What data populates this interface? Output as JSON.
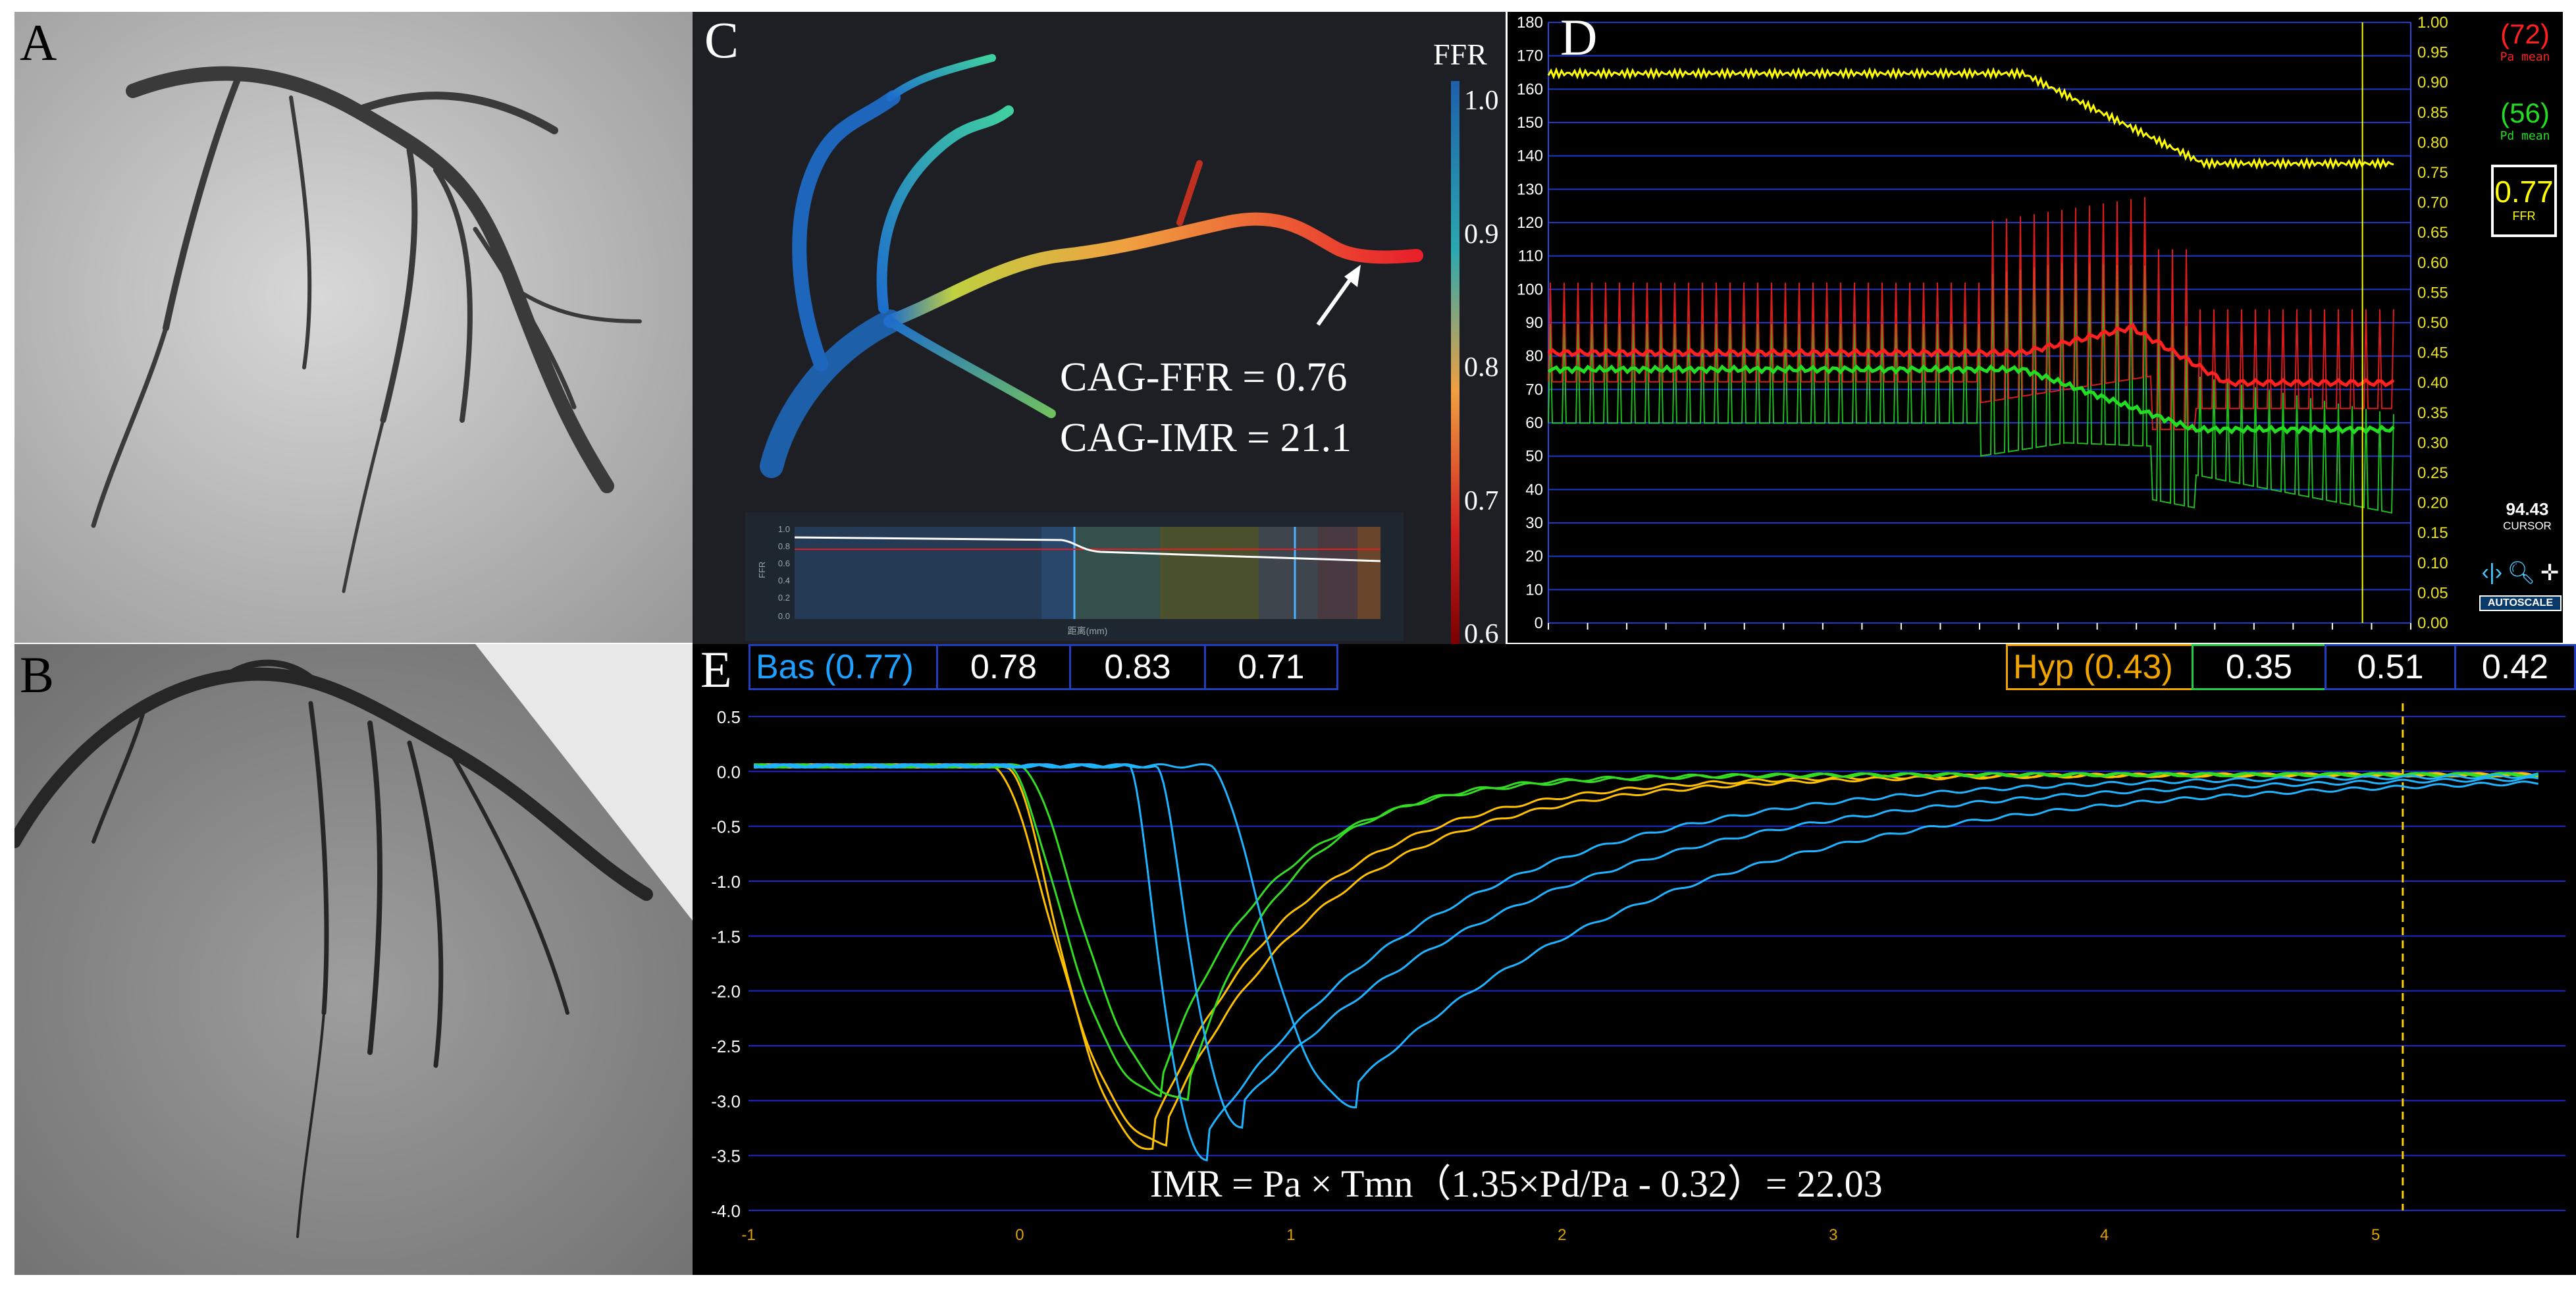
{
  "panels": {
    "A": {
      "label": "A"
    },
    "B": {
      "label": "B"
    },
    "C": {
      "label": "C",
      "colorbar_title": "FFR",
      "colorbar_ticks": [
        "1.0",
        "0.9",
        "0.8",
        "0.7",
        "0.6"
      ],
      "ffr_text": "CAG-FFR = 0.76",
      "imr_text": "CAG-IMR = 21.1",
      "mini_plot": {
        "ylabel": "FFR",
        "xlabel": "距离(mm)",
        "yticks": [
          "1.0",
          "0.8",
          "0.6",
          "0.4",
          "0.2",
          "0.0"
        ]
      }
    },
    "D": {
      "label": "D",
      "left_ticks": [
        "180",
        "170",
        "160",
        "150",
        "140",
        "130",
        "120",
        "110",
        "100",
        "90",
        "80",
        "70",
        "60",
        "50",
        "40",
        "30",
        "20",
        "10",
        "0"
      ],
      "right_ticks": [
        "1.00",
        "0.95",
        "0.90",
        "0.85",
        "0.80",
        "0.75",
        "0.70",
        "0.65",
        "0.60",
        "0.55",
        "0.50",
        "0.45",
        "0.40",
        "0.35",
        "0.30",
        "0.25",
        "0.20",
        "0.15",
        "0.10",
        "0.05",
        "0.00"
      ],
      "pa_value": "(72)",
      "pa_label": "Pa mean",
      "pd_value": "(56)",
      "pd_label": "Pd mean",
      "ffr_value": "0.77",
      "ffr_label": "FFR",
      "cursor_value": "94.43",
      "cursor_label": "CURSOR",
      "autoscale_label": "AUTOSCALE",
      "colors": {
        "ffr": "#ffff00",
        "pa": "#ff2020",
        "pd": "#22dd22"
      }
    },
    "E": {
      "label": "E",
      "bas_label": "Bas",
      "bas_mean": "(0.77)",
      "bas_values": [
        "0.78",
        "0.83",
        "0.71"
      ],
      "hyp_label": "Hyp",
      "hyp_mean": "(0.43)",
      "hyp_values": [
        "0.35",
        "0.51",
        "0.42"
      ],
      "y_ticks": [
        "0.5",
        "0.0",
        "-0.5",
        "-1.0",
        "-1.5",
        "-2.0",
        "-2.5",
        "-3.0",
        "-3.5",
        "-4.0"
      ],
      "x_ticks": [
        "-1",
        "0",
        "1",
        "2",
        "3",
        "4",
        "5"
      ],
      "formula": "IMR = Pa × Tmn（1.35×Pd/Pa - 0.32）= 22.03",
      "colors": {
        "bas": "#1eb4ff",
        "hyp": "#ffc000",
        "green": "#33dd22",
        "bas_header": "#1ea0ff",
        "hyp_header": "#f0a400"
      }
    }
  }
}
